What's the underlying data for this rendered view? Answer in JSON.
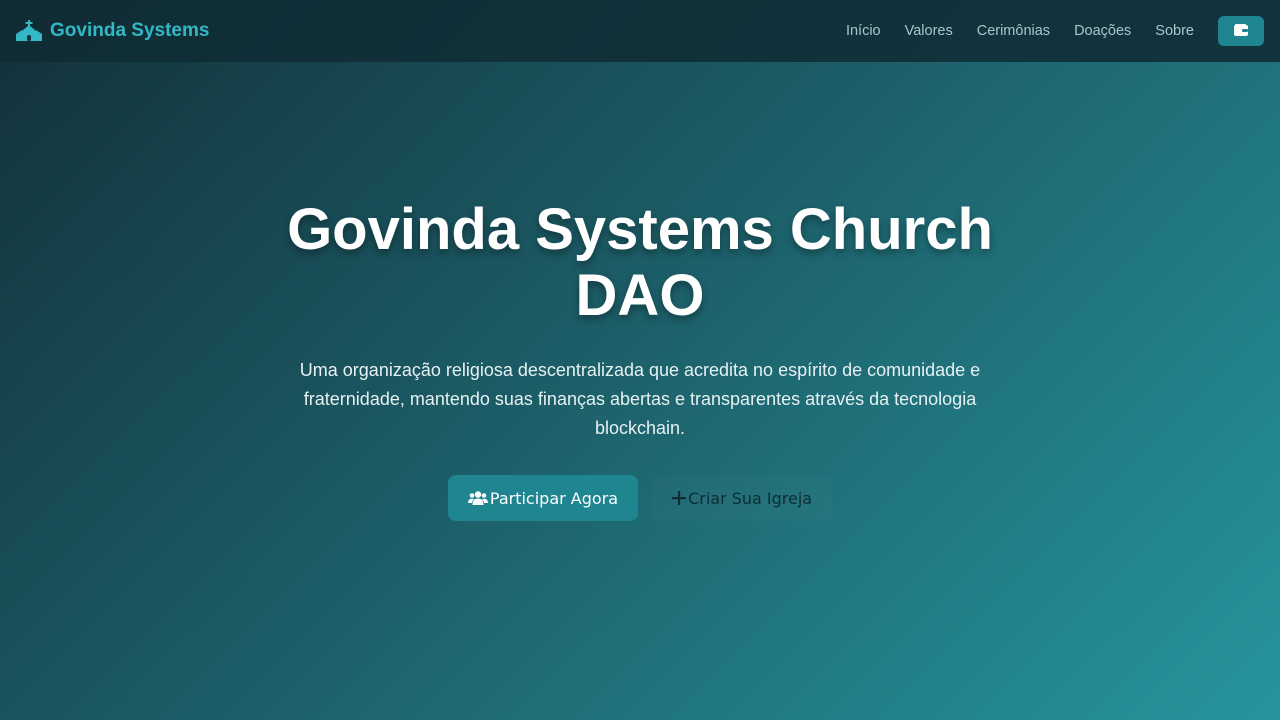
{
  "colors": {
    "brand": "#34b8c6",
    "primary_button": "#1f8590",
    "navbar_bg": "#102c34",
    "gradient_start": "#123039",
    "gradient_end": "#26959e"
  },
  "navbar": {
    "brand_icon": "church-icon",
    "brand_name": "Govinda Systems",
    "links": [
      {
        "label": "Início"
      },
      {
        "label": "Valores"
      },
      {
        "label": "Cerimônias"
      },
      {
        "label": "Doações"
      },
      {
        "label": "Sobre"
      }
    ],
    "wallet_icon": "wallet-icon"
  },
  "hero": {
    "title": "Govinda Systems Church DAO",
    "description": "Uma organização religiosa descentralizada que acredita no espírito de comunidade e fraternidade, mantendo suas finanças abertas e transparentes através da tecnologia blockchain.",
    "primary_button": {
      "icon": "users-icon",
      "label": "Participar Agora"
    },
    "secondary_button": {
      "icon": "plus-icon",
      "label": "Criar Sua Igreja"
    }
  }
}
